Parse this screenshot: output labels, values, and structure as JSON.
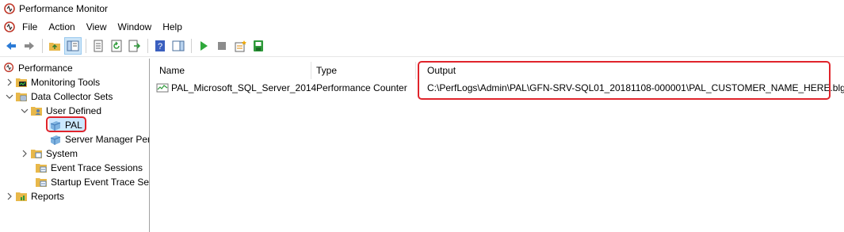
{
  "window": {
    "title": "Performance Monitor"
  },
  "menu": {
    "items": [
      "File",
      "Action",
      "View",
      "Window",
      "Help"
    ]
  },
  "toolbar": {
    "buttons": [
      "back-icon",
      "forward-icon",
      "up-folder-icon",
      "show-hide-tree-icon",
      "properties-icon",
      "refresh-icon",
      "export-list-icon",
      "help-icon",
      "show-hide-action-pane-icon",
      "start-icon",
      "stop-icon",
      "new-data-collector-icon",
      "save-icon"
    ]
  },
  "tree": {
    "root": "Performance",
    "monitoring_tools": "Monitoring Tools",
    "data_collector_sets": "Data Collector Sets",
    "user_defined": "User Defined",
    "pal": "PAL",
    "server_manager": "Server Manager Per",
    "system": "System",
    "event_trace_sessions": "Event Trace Sessions",
    "startup_event_trace": "Startup Event Trace Ses",
    "reports": "Reports"
  },
  "list": {
    "columns": {
      "name": "Name",
      "type": "Type",
      "output": "Output"
    },
    "rows": [
      {
        "name": "PAL_Microsoft_SQL_Server_2014",
        "type": "Performance Counter",
        "output": "C:\\PerfLogs\\Admin\\PAL\\GFN-SRV-SQL01_20181108-000001\\PAL_CUSTOMER_NAME_HERE.blg"
      }
    ]
  },
  "colors": {
    "highlight": "#e0242b",
    "selection": "#cce8ff",
    "folder": "#e8b84a"
  }
}
